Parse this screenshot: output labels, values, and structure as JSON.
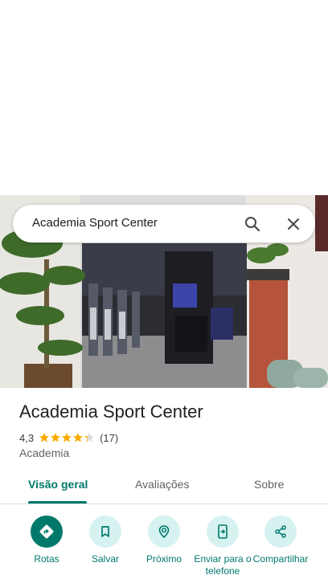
{
  "search": {
    "query": "Academia Sport Center"
  },
  "place": {
    "title": "Academia Sport Center",
    "rating": "4,3",
    "stars": 4.3,
    "review_count": "(17)",
    "category": "Academia"
  },
  "tabs": [
    {
      "label": "Visão geral",
      "active": true
    },
    {
      "label": "Avaliações",
      "active": false
    },
    {
      "label": "Sobre",
      "active": false
    }
  ],
  "actions": [
    {
      "label": "Rotas",
      "icon": "directions-icon"
    },
    {
      "label": "Salvar",
      "icon": "bookmark-icon"
    },
    {
      "label": "Próximo",
      "icon": "nearby-icon"
    },
    {
      "label": "Enviar para o telefone",
      "icon": "send-to-phone-icon"
    },
    {
      "label": "Compartilhar",
      "icon": "share-icon"
    }
  ],
  "colors": {
    "accent": "#00796b",
    "action_bg": "#d6f2f0",
    "star": "#f9ab00"
  }
}
